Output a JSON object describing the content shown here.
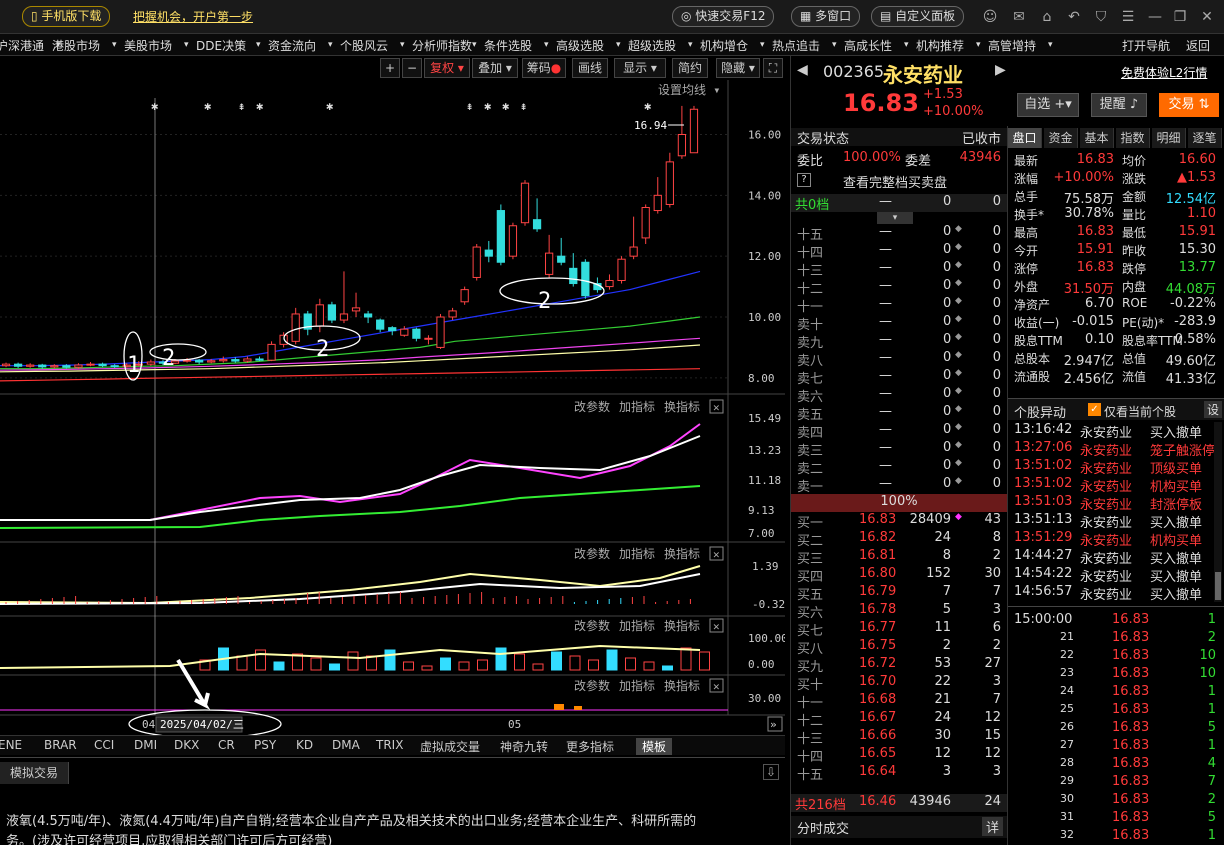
{
  "titlebar": {
    "mobile_download": "手机版下载",
    "promo_link": "把握机会，开户第一步",
    "quick_trade": "快速交易F12",
    "multi_window": "多窗口",
    "custom_panel": "自定义面板"
  },
  "menu": [
    "沪深港通",
    "港股市场",
    "美股市场",
    "DDE决策",
    "资金流向",
    "个股风云",
    "分析师指数",
    "条件选股",
    "高级选股",
    "超级选股",
    "机构增仓",
    "热点追击",
    "高成长性",
    "机构推荐",
    "高管增持",
    "打开导航",
    "返回"
  ],
  "chart_toolbar": {
    "plus": "+",
    "minus": "−",
    "fuquan": "复权",
    "diejia": "叠加",
    "chouma": "筹码",
    "huaxian": "画线",
    "xianshi": "显示",
    "jianyue": "简约",
    "yincang": "隐藏",
    "set_ma": "设置均线"
  },
  "chart_data": {
    "type": "candlestick",
    "y_ticks": [
      "16.00",
      "14.00",
      "12.00",
      "10.00",
      "8.00"
    ],
    "ylim": [
      7.6,
      17.2
    ],
    "max_label": "16.94",
    "annotations": [
      "1",
      "2",
      "2",
      "2"
    ],
    "candles": [
      {
        "o": 8.4,
        "c": 8.45,
        "h": 8.5,
        "l": 8.35
      },
      {
        "o": 8.45,
        "c": 8.38,
        "h": 8.5,
        "l": 8.32
      },
      {
        "o": 8.38,
        "c": 8.42,
        "h": 8.48,
        "l": 8.33
      },
      {
        "o": 8.42,
        "c": 8.36,
        "h": 8.46,
        "l": 8.3
      },
      {
        "o": 8.36,
        "c": 8.4,
        "h": 8.45,
        "l": 8.3
      },
      {
        "o": 8.4,
        "c": 8.35,
        "h": 8.45,
        "l": 8.3
      },
      {
        "o": 8.35,
        "c": 8.42,
        "h": 8.48,
        "l": 8.3
      },
      {
        "o": 8.42,
        "c": 8.45,
        "h": 8.52,
        "l": 8.38
      },
      {
        "o": 8.45,
        "c": 8.4,
        "h": 8.5,
        "l": 8.35
      },
      {
        "o": 8.4,
        "c": 8.38,
        "h": 8.45,
        "l": 8.32
      },
      {
        "o": 8.38,
        "c": 8.42,
        "h": 8.48,
        "l": 8.34
      },
      {
        "o": 8.42,
        "c": 8.45,
        "h": 8.55,
        "l": 8.38
      },
      {
        "o": 8.45,
        "c": 8.52,
        "h": 8.6,
        "l": 8.4
      },
      {
        "o": 8.52,
        "c": 8.48,
        "h": 8.58,
        "l": 8.42
      },
      {
        "o": 8.48,
        "c": 8.55,
        "h": 8.62,
        "l": 8.45
      },
      {
        "o": 8.55,
        "c": 8.58,
        "h": 8.65,
        "l": 8.5
      },
      {
        "o": 8.58,
        "c": 8.52,
        "h": 8.62,
        "l": 8.45
      },
      {
        "o": 8.52,
        "c": 8.56,
        "h": 8.62,
        "l": 8.48
      },
      {
        "o": 8.56,
        "c": 8.6,
        "h": 8.7,
        "l": 8.5
      },
      {
        "o": 8.6,
        "c": 8.55,
        "h": 8.68,
        "l": 8.5
      },
      {
        "o": 8.55,
        "c": 8.62,
        "h": 8.7,
        "l": 8.5
      },
      {
        "o": 8.62,
        "c": 8.58,
        "h": 8.7,
        "l": 8.55
      },
      {
        "o": 8.58,
        "c": 9.1,
        "h": 9.2,
        "l": 8.55
      },
      {
        "o": 9.1,
        "c": 9.4,
        "h": 9.5,
        "l": 9.0
      },
      {
        "o": 9.2,
        "c": 10.1,
        "h": 10.3,
        "l": 9.1
      },
      {
        "o": 10.1,
        "c": 9.6,
        "h": 10.2,
        "l": 9.4
      },
      {
        "o": 9.7,
        "c": 10.4,
        "h": 10.6,
        "l": 9.5
      },
      {
        "o": 10.4,
        "c": 9.9,
        "h": 10.5,
        "l": 9.8
      },
      {
        "o": 9.9,
        "c": 10.1,
        "h": 11.5,
        "l": 9.8
      },
      {
        "o": 10.2,
        "c": 10.3,
        "h": 10.8,
        "l": 10.0
      },
      {
        "o": 10.1,
        "c": 10.0,
        "h": 10.2,
        "l": 9.8
      },
      {
        "o": 9.9,
        "c": 9.6,
        "h": 9.95,
        "l": 9.5
      },
      {
        "o": 9.65,
        "c": 9.55,
        "h": 9.7,
        "l": 9.4
      },
      {
        "o": 9.4,
        "c": 9.6,
        "h": 9.7,
        "l": 9.35
      },
      {
        "o": 9.6,
        "c": 9.3,
        "h": 9.65,
        "l": 9.2
      },
      {
        "o": 9.3,
        "c": 9.3,
        "h": 9.4,
        "l": 9.1
      },
      {
        "o": 9.0,
        "c": 10.0,
        "h": 10.1,
        "l": 8.95
      },
      {
        "o": 10.0,
        "c": 10.2,
        "h": 10.3,
        "l": 9.9
      },
      {
        "o": 10.5,
        "c": 10.9,
        "h": 11.0,
        "l": 10.4
      },
      {
        "o": 11.3,
        "c": 12.3,
        "h": 12.4,
        "l": 11.2
      },
      {
        "o": 12.2,
        "c": 12.0,
        "h": 12.5,
        "l": 11.8
      },
      {
        "o": 13.5,
        "c": 11.8,
        "h": 13.7,
        "l": 11.7
      },
      {
        "o": 12.0,
        "c": 13.0,
        "h": 13.1,
        "l": 11.9
      },
      {
        "o": 13.1,
        "c": 14.4,
        "h": 14.5,
        "l": 13.0
      },
      {
        "o": 13.2,
        "c": 12.9,
        "h": 13.9,
        "l": 12.8
      },
      {
        "o": 11.4,
        "c": 12.1,
        "h": 12.7,
        "l": 11.3
      },
      {
        "o": 12.0,
        "c": 11.8,
        "h": 12.6,
        "l": 11.7
      },
      {
        "o": 11.6,
        "c": 11.1,
        "h": 12.1,
        "l": 11.0
      },
      {
        "o": 11.8,
        "c": 10.7,
        "h": 11.9,
        "l": 10.6
      },
      {
        "o": 11.1,
        "c": 10.9,
        "h": 11.3,
        "l": 10.8
      },
      {
        "o": 11.0,
        "c": 11.2,
        "h": 11.4,
        "l": 10.9
      },
      {
        "o": 11.2,
        "c": 11.9,
        "h": 12.0,
        "l": 11.1
      },
      {
        "o": 12.0,
        "c": 12.3,
        "h": 13.3,
        "l": 11.9
      },
      {
        "o": 12.6,
        "c": 13.6,
        "h": 13.7,
        "l": 12.4
      },
      {
        "o": 13.5,
        "c": 14.0,
        "h": 14.6,
        "l": 13.4
      },
      {
        "o": 13.7,
        "c": 15.1,
        "h": 15.4,
        "l": 13.6
      },
      {
        "o": 15.3,
        "c": 16.0,
        "h": 16.94,
        "l": 15.2
      },
      {
        "o": 15.4,
        "c": 16.83,
        "h": 16.94,
        "l": 15.4
      }
    ],
    "ma_lines": [
      {
        "name": "MA_blue",
        "color": "#2233ff",
        "values": [
          8.4,
          8.4,
          8.42,
          8.45,
          8.5,
          8.55,
          8.6,
          8.7,
          8.9,
          9.1,
          9.3,
          9.5,
          9.7,
          9.9,
          10.1,
          10.3,
          10.5,
          10.7,
          10.9,
          11.2,
          11.5
        ]
      },
      {
        "name": "MA_green",
        "color": "#33cc33",
        "values": [
          8.3,
          8.3,
          8.32,
          8.35,
          8.38,
          8.4,
          8.45,
          8.5,
          8.6,
          8.7,
          8.8,
          8.9,
          9.0,
          9.2,
          9.3,
          9.4,
          9.5,
          9.6,
          9.7,
          9.85,
          10.0
        ]
      },
      {
        "name": "MA_pink",
        "color": "#ee44ee",
        "values": [
          8.25,
          8.26,
          8.28,
          8.3,
          8.32,
          8.35,
          8.38,
          8.42,
          8.46,
          8.5,
          8.55,
          8.6,
          8.68,
          8.75,
          8.82,
          8.9,
          8.98,
          9.06,
          9.14,
          9.22,
          9.3
        ]
      },
      {
        "name": "MA_yellow",
        "color": "#ffffaa",
        "values": [
          8.2,
          8.21,
          8.22,
          8.24,
          8.26,
          8.28,
          8.3,
          8.34,
          8.38,
          8.42,
          8.46,
          8.5,
          8.56,
          8.62,
          8.68,
          8.74,
          8.8,
          8.86,
          8.92,
          9.0,
          9.08
        ]
      },
      {
        "name": "MA_red",
        "color": "#ff3333",
        "values": [
          7.9,
          7.92,
          7.94,
          7.96,
          7.98,
          8.0,
          8.02,
          8.04,
          8.06,
          8.08,
          8.1,
          8.12,
          8.14,
          8.16,
          8.18,
          8.2,
          8.22,
          8.24,
          8.26,
          8.28,
          8.3
        ]
      }
    ],
    "sub1_ticks": [
      "15.49",
      "13.23",
      "11.18",
      "9.13",
      "7.00"
    ],
    "sub2_ticks": [
      "1.39",
      "-0.32"
    ],
    "sub3_ticks": [
      "100.00",
      "0.00"
    ],
    "sub4_ticks": [
      "30.00"
    ],
    "x_labels": [
      "04",
      "2025/04/02/三",
      "05"
    ]
  },
  "panel_btns": {
    "gaicanshu": "改参数",
    "jiazhibiao": "加指标",
    "huanzhibiao": "换指标"
  },
  "indicator_tabs": [
    "ENE",
    "BRAR",
    "CCI",
    "DMI",
    "DKX",
    "CR",
    "PSY",
    "KD",
    "DMA",
    "TRIX",
    "虚拟成交量",
    "神奇九转",
    "更多指标",
    "模板"
  ],
  "bottom": {
    "tab": "模拟交易",
    "line1": "液氧(4.5万吨/年)、液氮(4.4万吨/年)自产自销;经营本企业自产产品及相关技术的出口业务;经营本企业生产、科研所需的",
    "line2": "务。(涉及许可经营项目,应取得相关部门许可后方可经营)"
  },
  "stock": {
    "code": "002365",
    "name": "永安药业",
    "price": "16.83",
    "change": "+1.53",
    "pct": "+10.00%",
    "free_l2": "免费体验L2行情",
    "zixuan": "自选",
    "tixing": "提醒",
    "jiaoyi": "交易"
  },
  "orderbook": {
    "status_label": "交易状态",
    "status_value": "已收市",
    "weibi_label": "委比",
    "weibi_value": "100.00%",
    "weicha_label": "委差",
    "weicha_value": "43946",
    "view_full": "查看完整档买卖盘",
    "help": "?",
    "total_sell_label": "共0档",
    "total_sell_dash": "—",
    "total_sell_a": "0",
    "total_sell_b": "0",
    "sell_rows": [
      "十五",
      "十四",
      "十三",
      "十二",
      "十一",
      "卖十",
      "卖九",
      "卖八",
      "卖七",
      "卖六",
      "卖五",
      "卖四",
      "卖三",
      "卖二",
      "卖一"
    ],
    "ratio": "100%",
    "buy_rows": [
      {
        "label": "买一",
        "price": "16.83",
        "vol": "28409",
        "n": "43"
      },
      {
        "label": "买二",
        "price": "16.82",
        "vol": "24",
        "n": "8"
      },
      {
        "label": "买三",
        "price": "16.81",
        "vol": "8",
        "n": "2"
      },
      {
        "label": "买四",
        "price": "16.80",
        "vol": "152",
        "n": "30"
      },
      {
        "label": "买五",
        "price": "16.79",
        "vol": "7",
        "n": "7"
      },
      {
        "label": "买六",
        "price": "16.78",
        "vol": "5",
        "n": "3"
      },
      {
        "label": "买七",
        "price": "16.77",
        "vol": "11",
        "n": "6"
      },
      {
        "label": "买八",
        "price": "16.75",
        "vol": "2",
        "n": "2"
      },
      {
        "label": "买九",
        "price": "16.72",
        "vol": "53",
        "n": "27"
      },
      {
        "label": "买十",
        "price": "16.70",
        "vol": "22",
        "n": "3"
      },
      {
        "label": "十一",
        "price": "16.68",
        "vol": "21",
        "n": "7"
      },
      {
        "label": "十二",
        "price": "16.67",
        "vol": "24",
        "n": "12"
      },
      {
        "label": "十三",
        "price": "16.66",
        "vol": "30",
        "n": "15"
      },
      {
        "label": "十四",
        "price": "16.65",
        "vol": "12",
        "n": "12"
      },
      {
        "label": "十五",
        "price": "16.64",
        "vol": "3",
        "n": "3"
      }
    ],
    "total_buy_label": "共216档",
    "total_buy_price": "16.46",
    "total_buy_vol": "43946",
    "total_buy_n": "24",
    "fenshi_label": "分时成交",
    "fenshi_btn": "详"
  },
  "info_tabs": [
    "盘口",
    "资金",
    "基本",
    "指数",
    "明细",
    "逐笔"
  ],
  "info_rows": [
    {
      "l1": "最新",
      "v1": "16.83",
      "l2": "均价",
      "v2": "16.60"
    },
    {
      "l1": "涨幅",
      "v1": "+10.00%",
      "l2": "涨跌",
      "v2": "▲1.53"
    },
    {
      "l1": "总手",
      "v1": "75.58万",
      "l2": "金额",
      "v2": "12.54亿"
    },
    {
      "l1": "换手*",
      "v1": "30.78%",
      "l2": "量比",
      "v2": "1.10"
    },
    {
      "l1": "最高",
      "v1": "16.83",
      "l2": "最低",
      "v2": "15.91"
    },
    {
      "l1": "今开",
      "v1": "15.91",
      "l2": "昨收",
      "v2": "15.30"
    },
    {
      "l1": "涨停",
      "v1": "16.83",
      "l2": "跌停",
      "v2": "13.77"
    },
    {
      "l1": "外盘",
      "v1": "31.50万",
      "l2": "内盘",
      "v2": "44.08万"
    },
    {
      "l1": "净资产",
      "v1": "6.70",
      "l2": "ROE",
      "v2": "-0.22%"
    },
    {
      "l1": "收益(一)",
      "v1": "-0.015",
      "l2": "PE(动)*",
      "v2": "-283.9"
    },
    {
      "l1": "股息TTM",
      "v1": "0.10",
      "l2": "股息率TTM",
      "v2": "0.58%"
    },
    {
      "l1": "总股本",
      "v1": "2.947亿",
      "l2": "总值",
      "v2": "49.60亿"
    },
    {
      "l1": "流通股",
      "v1": "2.456亿",
      "l2": "流值",
      "v2": "41.33亿"
    }
  ],
  "yidong": {
    "title": "个股异动",
    "only_current": "仅看当前个股",
    "settings": "设",
    "rows": [
      {
        "t": "13:16:42",
        "n": "永安药业",
        "e": "买入撤单",
        "hot": false
      },
      {
        "t": "13:27:06",
        "n": "永安药业",
        "e": "笼子触涨停",
        "hot": true
      },
      {
        "t": "13:51:02",
        "n": "永安药业",
        "e": "顶级买单",
        "hot": true
      },
      {
        "t": "13:51:02",
        "n": "永安药业",
        "e": "机构买单",
        "hot": true
      },
      {
        "t": "13:51:03",
        "n": "永安药业",
        "e": "封涨停板",
        "hot": true
      },
      {
        "t": "13:51:13",
        "n": "永安药业",
        "e": "买入撤单",
        "hot": false
      },
      {
        "t": "13:51:29",
        "n": "永安药业",
        "e": "机构买单",
        "hot": true
      },
      {
        "t": "14:44:27",
        "n": "永安药业",
        "e": "买入撤单",
        "hot": false
      },
      {
        "t": "14:54:22",
        "n": "永安药业",
        "e": "买入撤单",
        "hot": false
      },
      {
        "t": "14:56:57",
        "n": "永安药业",
        "e": "买入撤单",
        "hot": false
      }
    ]
  },
  "ticks": [
    {
      "t": "15:00:00",
      "p": "16.83",
      "v": "1"
    },
    {
      "t": "21",
      "p": "16.83",
      "v": "2"
    },
    {
      "t": "22",
      "p": "16.83",
      "v": "10"
    },
    {
      "t": "23",
      "p": "16.83",
      "v": "10"
    },
    {
      "t": "24",
      "p": "16.83",
      "v": "1"
    },
    {
      "t": "25",
      "p": "16.83",
      "v": "1"
    },
    {
      "t": "26",
      "p": "16.83",
      "v": "5"
    },
    {
      "t": "27",
      "p": "16.83",
      "v": "1"
    },
    {
      "t": "28",
      "p": "16.83",
      "v": "4"
    },
    {
      "t": "29",
      "p": "16.83",
      "v": "7"
    },
    {
      "t": "30",
      "p": "16.83",
      "v": "2"
    },
    {
      "t": "31",
      "p": "16.83",
      "v": "5"
    },
    {
      "t": "32",
      "p": "16.83",
      "v": "1"
    }
  ]
}
